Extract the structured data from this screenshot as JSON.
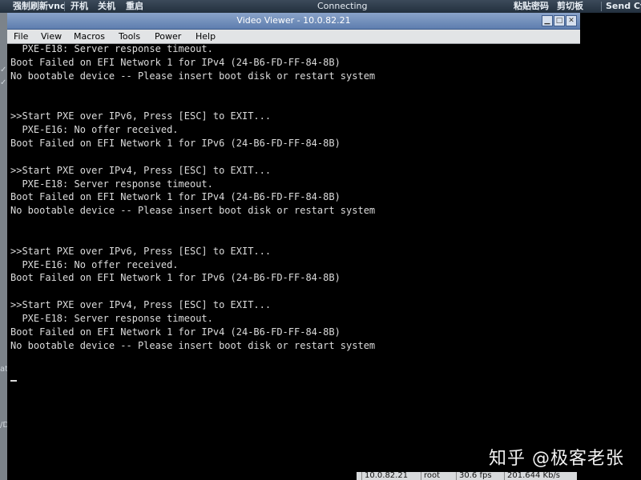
{
  "vnc_toolbar": {
    "force_refresh": "强制刷新vnc",
    "power_on": "开机",
    "power_off": "关机",
    "restart": "重启",
    "status": "Connecting",
    "paste_password": "粘贴密码",
    "clipboard": "剪切板",
    "send_ctrl": "Send Ctr"
  },
  "outer_left_fragments": [
    "✓",
    "✓",
    "ate",
    "/D"
  ],
  "window": {
    "title": "Video Viewer - 10.0.82.21",
    "menu": [
      "File",
      "View",
      "Macros",
      "Tools",
      "Power",
      "Help"
    ]
  },
  "console_lines": [
    "  PXE-E18: Server response timeout.",
    "Boot Failed on EFI Network 1 for IPv4 (24-B6-FD-FF-84-8B)",
    "No bootable device -- Please insert boot disk or restart system",
    "",
    "",
    ">>Start PXE over IPv6, Press [ESC] to EXIT...",
    "  PXE-E16: No offer received.",
    "Boot Failed on EFI Network 1 for IPv6 (24-B6-FD-FF-84-8B)",
    "",
    ">>Start PXE over IPv4, Press [ESC] to EXIT...",
    "  PXE-E18: Server response timeout.",
    "Boot Failed on EFI Network 1 for IPv4 (24-B6-FD-FF-84-8B)",
    "No bootable device -- Please insert boot disk or restart system",
    "",
    "",
    ">>Start PXE over IPv6, Press [ESC] to EXIT...",
    "  PXE-E16: No offer received.",
    "Boot Failed on EFI Network 1 for IPv6 (24-B6-FD-FF-84-8B)",
    "",
    ">>Start PXE over IPv4, Press [ESC] to EXIT...",
    "  PXE-E18: Server response timeout.",
    "Boot Failed on EFI Network 1 for IPv4 (24-B6-FD-FF-84-8B)",
    "No bootable device -- Please insert boot disk or restart system"
  ],
  "status_bar": {
    "ip": "10.0.82.21",
    "user": "root",
    "fps": "30.6 fps",
    "rate": "201.644 Kb/s"
  },
  "watermark": "知乎 @极客老张"
}
